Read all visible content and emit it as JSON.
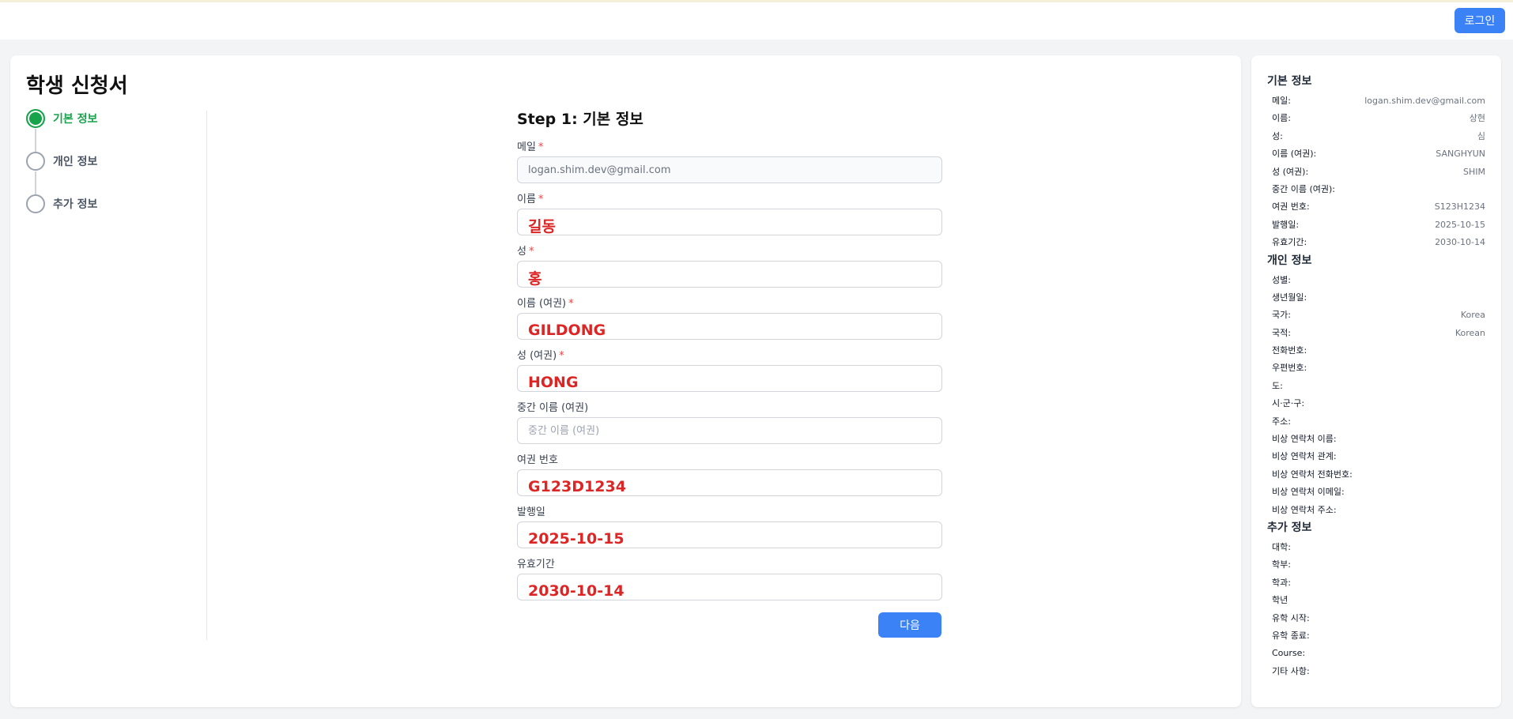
{
  "header": {
    "login_label": "로그인"
  },
  "page": {
    "title": "학생 신청서"
  },
  "steps": [
    {
      "label": "기본 정보",
      "active": true
    },
    {
      "label": "개인 정보",
      "active": false
    },
    {
      "label": "추가 정보",
      "active": false
    }
  ],
  "form": {
    "step_title": "Step 1: 기본 정보",
    "fields": {
      "email": {
        "label": "메일",
        "required": "*",
        "value": "logan.shim.dev@gmail.com"
      },
      "first_name": {
        "label": "이름",
        "required": "*",
        "value": "길동"
      },
      "last_name": {
        "label": "성",
        "required": "*",
        "value": "홍"
      },
      "first_name_passport": {
        "label": "이름 (여권)",
        "required": "*",
        "value": "GILDONG"
      },
      "last_name_passport": {
        "label": "성 (여권)",
        "required": "*",
        "value": "HONG"
      },
      "middle_name_passport": {
        "label": "중간 이름 (여권)",
        "value": "",
        "placeholder": "중간 이름 (여권)"
      },
      "passport_number": {
        "label": "여권 번호",
        "value": "G123D1234"
      },
      "issue_date": {
        "label": "발행일",
        "value": "2025-10-15"
      },
      "expiry_date": {
        "label": "유효기간",
        "value": "2030-10-14"
      }
    },
    "next_label": "다음"
  },
  "summary": {
    "basic": {
      "title": "기본 정보",
      "rows": [
        {
          "k": "메일:",
          "v": "logan.shim.dev@gmail.com"
        },
        {
          "k": "이름:",
          "v": "상현"
        },
        {
          "k": "성:",
          "v": "심"
        },
        {
          "k": "이름 (여권):",
          "v": "SANGHYUN"
        },
        {
          "k": "성 (여권):",
          "v": "SHIM"
        },
        {
          "k": "중간 이름 (여권):",
          "v": ""
        },
        {
          "k": "여권 번호:",
          "v": "S123H1234"
        },
        {
          "k": "발행일:",
          "v": "2025-10-15"
        },
        {
          "k": "유효기간:",
          "v": "2030-10-14"
        }
      ]
    },
    "personal": {
      "title": "개인 정보",
      "rows": [
        {
          "k": "성별:",
          "v": ""
        },
        {
          "k": "생년월일:",
          "v": ""
        },
        {
          "k": "국가:",
          "v": "Korea"
        },
        {
          "k": "국적:",
          "v": "Korean"
        },
        {
          "k": "전화번호:",
          "v": ""
        },
        {
          "k": "우편번호:",
          "v": ""
        },
        {
          "k": "도:",
          "v": ""
        },
        {
          "k": "시·군·구:",
          "v": ""
        },
        {
          "k": "주소:",
          "v": ""
        },
        {
          "k": "비상 연락처 이름:",
          "v": ""
        },
        {
          "k": "비상 연락처 관계:",
          "v": ""
        },
        {
          "k": "비상 연락처 전화번호:",
          "v": ""
        },
        {
          "k": "비상 연락처 이메일:",
          "v": ""
        },
        {
          "k": "비상 연락처 주소:",
          "v": ""
        }
      ]
    },
    "additional": {
      "title": "추가 정보",
      "rows": [
        {
          "k": "대학:",
          "v": ""
        },
        {
          "k": "학부:",
          "v": ""
        },
        {
          "k": "학과:",
          "v": ""
        },
        {
          "k": "학년",
          "v": ""
        },
        {
          "k": "유학 시작:",
          "v": ""
        },
        {
          "k": "유학 종료:",
          "v": ""
        },
        {
          "k": "Course:",
          "v": ""
        },
        {
          "k": "기타 사항:",
          "v": ""
        }
      ]
    }
  }
}
